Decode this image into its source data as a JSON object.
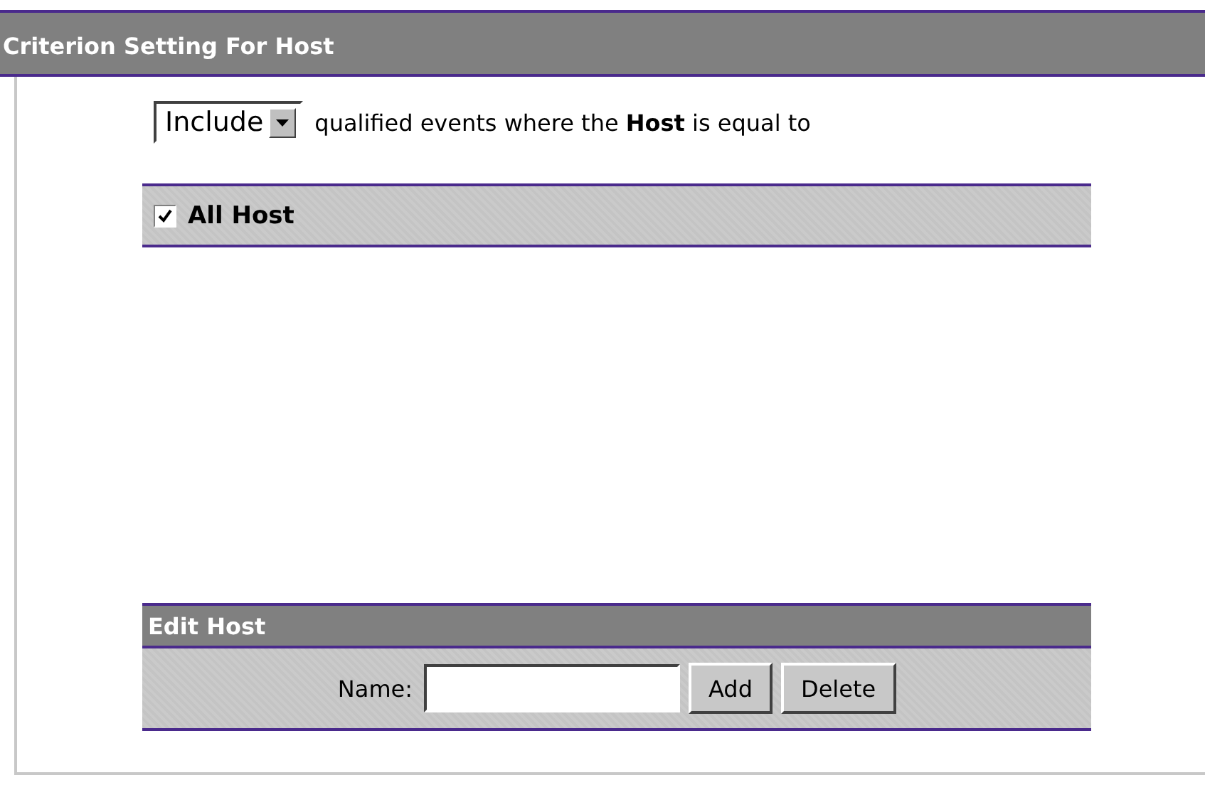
{
  "title": "Criterion Setting For Host",
  "filter": {
    "mode": "Include",
    "sentence": "qualified events where the **Host** is equal to"
  },
  "all_host": {
    "label": "All Host",
    "checked": true
  },
  "edit": {
    "title": "Edit Host",
    "name_label": "Name:",
    "buttons": [
      "Add",
      "Delete"
    ]
  }
}
